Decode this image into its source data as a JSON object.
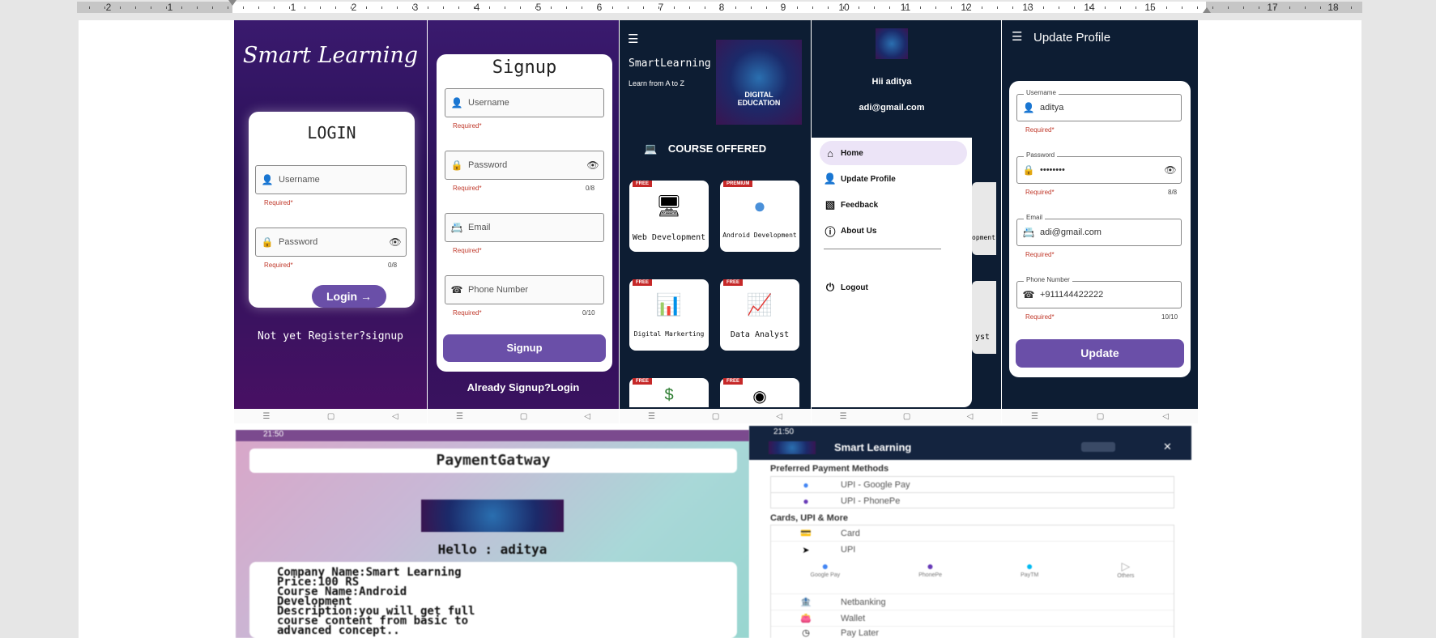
{
  "ruler": {
    "numbers": [
      "2",
      "1",
      "1",
      "2",
      "3",
      "4",
      "5",
      "6",
      "7",
      "8",
      "9",
      "10",
      "11",
      "12",
      "13",
      "14",
      "15",
      "17",
      "18"
    ]
  },
  "login": {
    "brand": "Smart Learning",
    "title": "LOGIN",
    "username_placeholder": "Username",
    "password_placeholder": "Password",
    "required": "Required*",
    "password_counter": "0/8",
    "login_button": "Login",
    "signup_link": "Not yet Register?signup"
  },
  "signup": {
    "title": "Signup",
    "username_placeholder": "Username",
    "password_placeholder": "Password",
    "email_placeholder": "Email",
    "phone_placeholder": "Phone Number",
    "required": "Required*",
    "password_counter": "0/8",
    "phone_counter": "0/10",
    "signup_button": "Signup",
    "login_link": "Already Signup?Login"
  },
  "courses": {
    "app_name": "SmartLearning",
    "tagline": "Learn from A to Z",
    "banner_text": "DIGITAL EDUCATION",
    "section_title": "COURSE OFFERED",
    "items": [
      {
        "name": "Web Development",
        "badge": "FREE"
      },
      {
        "name": "Android Development",
        "badge": "PREMIUM"
      },
      {
        "name": "Digital Marketing",
        "badge": "FREE"
      },
      {
        "name": "Data Analyst",
        "badge": "FREE"
      },
      {
        "name": "",
        "badge": "FREE"
      },
      {
        "name": "",
        "badge": "FREE"
      }
    ],
    "items_display": [
      "Web Development",
      "Android Development",
      "Digital Markerting",
      "Data Analyst"
    ]
  },
  "drawer": {
    "greeting": "Hii aditya",
    "email": "adi@gmail.com",
    "menu": [
      "Home",
      "Update Profile",
      "Feedback",
      "About Us"
    ],
    "logout": "Logout",
    "peek_texts": [
      "opment",
      "yst"
    ]
  },
  "update_profile": {
    "title": "Update Profile",
    "username_label": "Username",
    "username_value": "aditya",
    "password_label": "Password",
    "password_value": "••••••••",
    "password_counter": "8/8",
    "email_label": "Email",
    "email_value": "adi@gmail.com",
    "phone_label": "Phone Number",
    "phone_value": "+911144422222",
    "phone_counter": "10/10",
    "required": "Required*",
    "update_button": "Update"
  },
  "payment": {
    "status_time": "21:50",
    "title": "PaymentGatway",
    "hello": "Hello : aditya",
    "details": [
      "Company Name:Smart Learning",
      "Price:100 RS",
      "Course Name:Android",
      "Development",
      "Description:you will get full",
      "course content from basic to",
      "advanced concept.."
    ]
  },
  "checkout": {
    "status_time": "21:50",
    "title": "Smart Learning",
    "preferred_heading": "Preferred Payment Methods",
    "preferred": [
      "UPI - Google Pay",
      "UPI - PhonePe"
    ],
    "cards_heading": "Cards, UPI & More",
    "methods": [
      "Card",
      "UPI",
      "Netbanking",
      "Wallet",
      "Pay Later"
    ],
    "upi_apps": [
      "Google Pay",
      "PhonePe",
      "PayTM",
      "Others"
    ]
  }
}
